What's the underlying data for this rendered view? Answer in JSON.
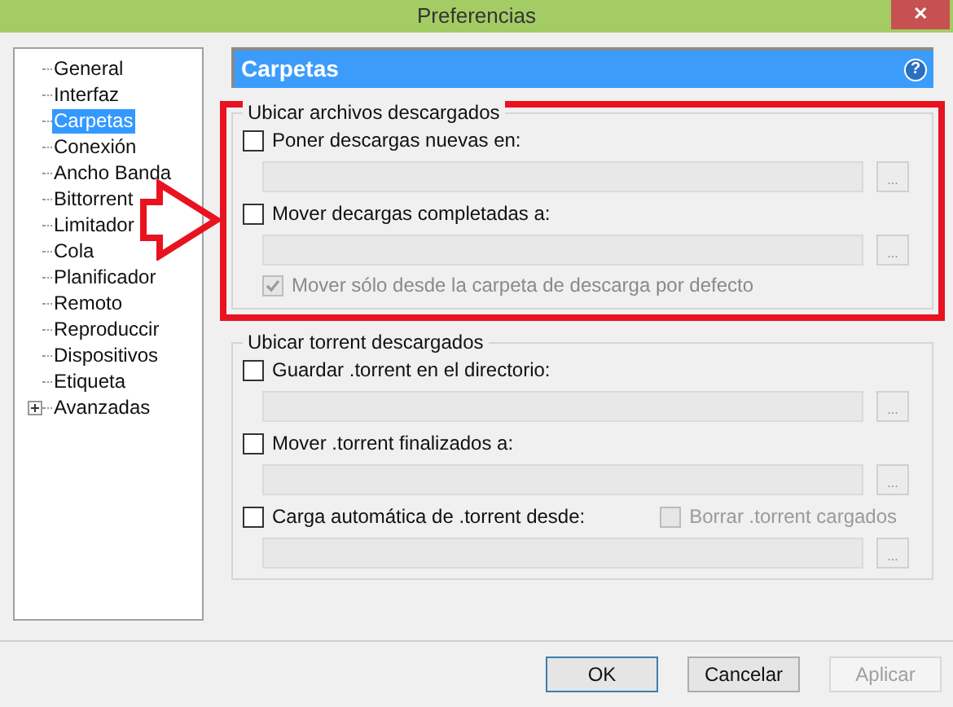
{
  "window": {
    "title": "Preferencias",
    "close": "✕"
  },
  "sidebar": {
    "items": [
      {
        "label": "General",
        "selected": false
      },
      {
        "label": "Interfaz",
        "selected": false
      },
      {
        "label": "Carpetas",
        "selected": true
      },
      {
        "label": "Conexión",
        "selected": false
      },
      {
        "label": "Ancho Banda",
        "selected": false
      },
      {
        "label": "Bittorrent",
        "selected": false
      },
      {
        "label": "Limitador",
        "selected": false
      },
      {
        "label": "Cola",
        "selected": false
      },
      {
        "label": "Planificador",
        "selected": false
      },
      {
        "label": "Remoto",
        "selected": false
      },
      {
        "label": "Reproduccir",
        "selected": false
      },
      {
        "label": "Dispositivos",
        "selected": false
      },
      {
        "label": "Etiqueta",
        "selected": false
      },
      {
        "label": "Avanzadas",
        "selected": false,
        "expanded": false
      }
    ]
  },
  "panel": {
    "title": "Carpetas",
    "help": "?",
    "groups": [
      {
        "legend": "Ubicar archivos descargados",
        "highlighted": true,
        "rows": [
          {
            "kind": "check",
            "label": "Poner descargas nuevas en:",
            "checked": false,
            "disabled": false
          },
          {
            "kind": "path",
            "disabled": true,
            "button": "..."
          },
          {
            "kind": "check",
            "label": "Mover decargas completadas a:",
            "checked": false,
            "disabled": false
          },
          {
            "kind": "path",
            "disabled": true,
            "button": "..."
          },
          {
            "kind": "subcheck",
            "label": "Mover sólo desde la carpeta de descarga por defecto",
            "checked": true,
            "disabled": true
          }
        ]
      },
      {
        "legend": "Ubicar torrent descargados",
        "highlighted": false,
        "rows": [
          {
            "kind": "check",
            "label": "Guardar .torrent en el directorio:",
            "checked": false,
            "disabled": false
          },
          {
            "kind": "path",
            "disabled": true,
            "button": "..."
          },
          {
            "kind": "check",
            "label": "Mover .torrent finalizados a:",
            "checked": false,
            "disabled": false
          },
          {
            "kind": "path",
            "disabled": true,
            "button": "..."
          },
          {
            "kind": "check",
            "label": "Carga automática de .torrent desde:",
            "checked": false,
            "disabled": false,
            "extra": {
              "label": "Borrar .torrent cargados",
              "checked": false,
              "disabled": true
            }
          },
          {
            "kind": "path",
            "disabled": true,
            "button": "..."
          }
        ]
      }
    ]
  },
  "buttons": [
    {
      "label": "OK",
      "default": true,
      "disabled": false
    },
    {
      "label": "Cancelar",
      "default": false,
      "disabled": false
    },
    {
      "label": "Aplicar",
      "default": false,
      "disabled": true
    }
  ]
}
